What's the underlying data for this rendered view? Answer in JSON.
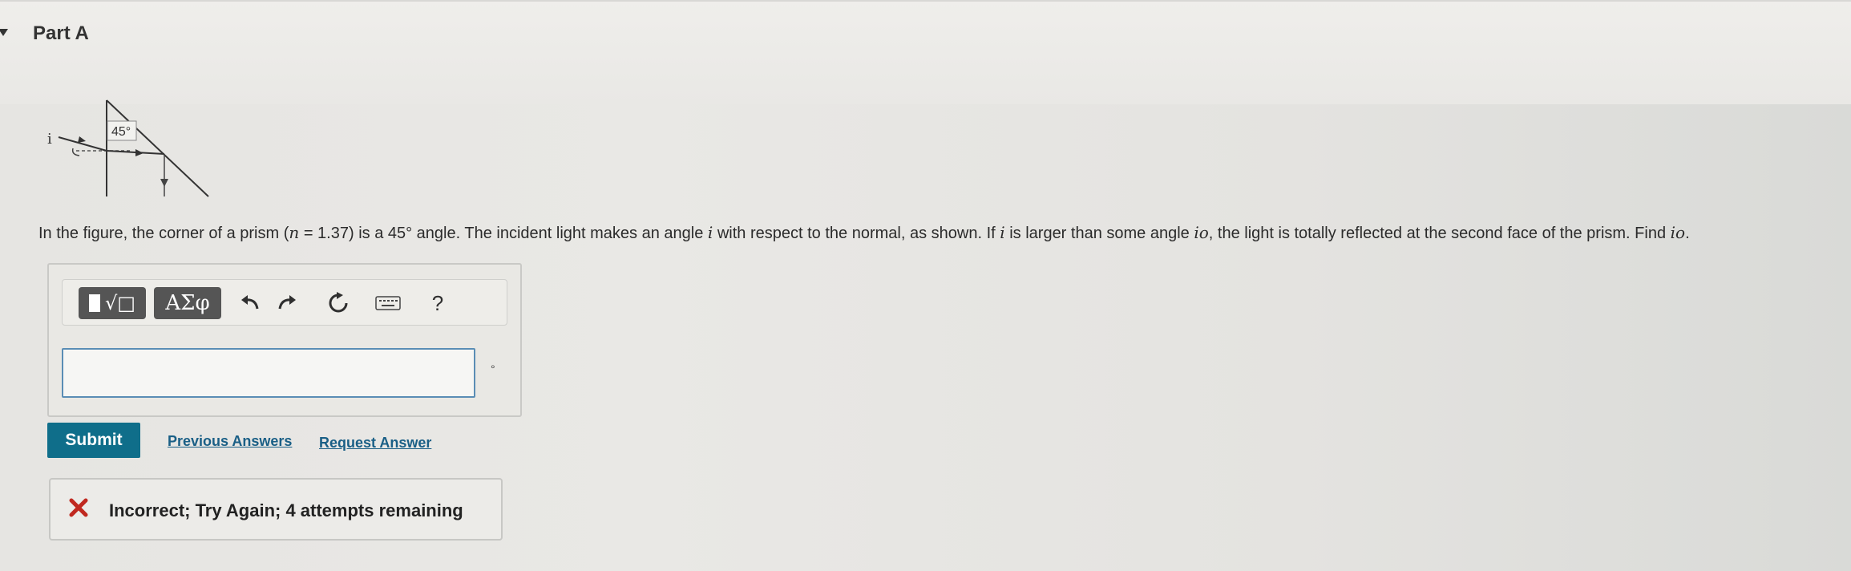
{
  "part": {
    "title": "Part A"
  },
  "figure": {
    "angle_label": "45°",
    "incident_label": "i"
  },
  "problem": {
    "text_1": "In the figure, the corner of a prism (",
    "n_symbol": "n",
    "text_2": " = 1.37) is a 45° angle. The incident light makes an angle ",
    "i_symbol": "i",
    "text_3": " with respect to the normal, as shown. If ",
    "i_symbol_2": "i",
    "text_4": " is larger than some angle ",
    "io_symbol": "io",
    "text_5": ", the light is totally reflected at the second face of the prism. Find ",
    "io_symbol_2": "io",
    "text_6": "."
  },
  "toolbar": {
    "templates_label": "√□",
    "symbols_label": "ΑΣφ",
    "help_label": "?"
  },
  "answer": {
    "value": "",
    "unit": "°"
  },
  "actions": {
    "submit_label": "Submit",
    "previous_answers_label": "Previous Answers",
    "request_answer_label": "Request Answer"
  },
  "feedback": {
    "message": "Incorrect; Try Again; 4 attempts remaining",
    "status_color": "#c0281f"
  }
}
